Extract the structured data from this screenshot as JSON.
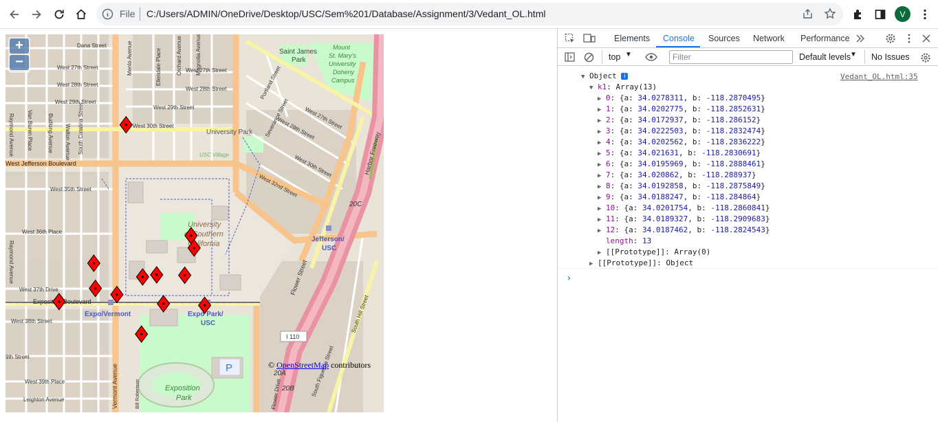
{
  "browser": {
    "file_label": "File",
    "url": "C:/Users/ADMIN/OneDrive/Desktop/USC/Sem%201/Database/Assignment/3/Vedant_OL.html",
    "avatar_letter": "V"
  },
  "map": {
    "zoom_in": "+",
    "zoom_out": "−",
    "attribution_prefix": "© ",
    "attribution_link": "OpenStreetMap",
    "attribution_suffix": " contributors",
    "colors": {
      "land": "#f2efe9",
      "campus": "#e9e2d6",
      "major_road": "#fcd6a4",
      "motorway": "#e892a2",
      "park": "#c8facc",
      "marker": "#ff0000"
    },
    "labels": {
      "dana": "Dana Street",
      "w27a": "West 27th Street",
      "w28a": "West 28th Street",
      "w29a": "West 29th Street",
      "w29b": "West 29th Street",
      "w30": "West 30th Street",
      "w27b": "West 27th Street",
      "w28b": "West 28th Street",
      "w30b": "West 30th Street",
      "w32": "West 32nd Street",
      "w35": "West 35th Street",
      "w36": "West 36th Place",
      "w37": "West 37th Drive",
      "w38": "West 38th Street",
      "w39": "West 39th Place",
      "ninth": "9th Street",
      "leighton": "Leighton Avenue",
      "jefferson": "West Jefferson Boulevard",
      "exposition": "Exposition Boulevard",
      "expo_vermont": "Expo/Vermont",
      "expo_park": "Expo Park/",
      "expo_park2": "USC",
      "jeff_usc": "Jefferson/",
      "jeff_usc2": "USC",
      "usc1": "University",
      "usc2": "of Southern",
      "usc3": "California",
      "univ_park": "University Park",
      "usc_village": "USC Village",
      "saint_james": "Saint James",
      "saint_james2": "Park",
      "mount1": "Mount",
      "mount2": "St. Mary's",
      "mount3": "University",
      "mount4": "Doheny",
      "mount5": "Campus",
      "expo_park_label": "Exposition",
      "expo_park_label2": "Park",
      "menlo": "Menlo Avenue",
      "ellendale": "Ellendale Place",
      "orchard": "Orchard Avenue",
      "magnolia": "Magnolia Avenue",
      "raymond": "Raymond Avenue",
      "vanburen": "Van Buren Place",
      "budlong": "Budlong Avenue",
      "walton": "Walton Avenue",
      "catalina": "South Catalina Street",
      "vermont": "Vermont Avenue",
      "portland": "Portland Street",
      "severance": "Severance Street",
      "flower": "Flower Street",
      "figueroa": "South Figueroa Street",
      "southhill": "South Hill Street",
      "harbor": "Harbor Freeway",
      "i110": "I 110",
      "r20c": "20C",
      "r20a": "20A",
      "r20b": "20B",
      "flower_drive": "Flower Drive",
      "bill_rob": "Bill Robertson",
      "parking": "P"
    }
  },
  "devtools": {
    "tabs": [
      "Elements",
      "Console",
      "Sources",
      "Network",
      "Performance"
    ],
    "active_tab": "Console",
    "context": "top",
    "filter_placeholder": "Filter",
    "levels": "Default levels",
    "issues": "No Issues",
    "source": "Vedant_OL.html:35",
    "object_label": "Object",
    "array_key": "k1",
    "array_label": "Array(13)",
    "entries": [
      {
        "i": "0",
        "a": "34.0278311",
        "b": "-118.2870495"
      },
      {
        "i": "1",
        "a": "34.0202775",
        "b": "-118.2852631"
      },
      {
        "i": "2",
        "a": "34.0172937",
        "b": "-118.286152"
      },
      {
        "i": "3",
        "a": "34.0222503",
        "b": "-118.2832474"
      },
      {
        "i": "4",
        "a": "34.0202562",
        "b": "-118.2836222"
      },
      {
        "i": "5",
        "a": "34.021631",
        "b": "-118.2830691"
      },
      {
        "i": "6",
        "a": "34.0195969",
        "b": "-118.2888461"
      },
      {
        "i": "7",
        "a": "34.020862",
        "b": "-118.288937"
      },
      {
        "i": "8",
        "a": "34.0192858",
        "b": "-118.2875849"
      },
      {
        "i": "9",
        "a": "34.0188247",
        "b": "-118.284864"
      },
      {
        "i": "10",
        "a": "34.0201754",
        "b": "-118.2860841"
      },
      {
        "i": "11",
        "a": "34.0189327",
        "b": "-118.2909683"
      },
      {
        "i": "12",
        "a": "34.0187462",
        "b": "-118.2824543"
      }
    ],
    "length_key": "length",
    "length_value": "13",
    "proto_key": "[[Prototype]]",
    "proto_array": "Array(0)",
    "proto_object": "Object",
    "prompt": "›"
  }
}
